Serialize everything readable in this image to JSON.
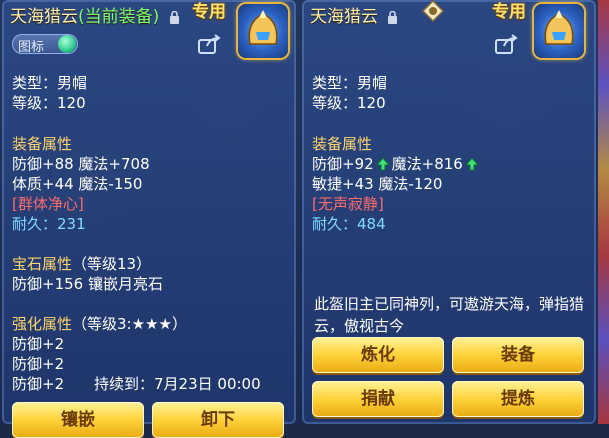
{
  "left": {
    "title": "天海猎云",
    "current_tag": "(当前装备)",
    "badge": "专用",
    "icon_toggle_label": "图标",
    "type": "类型：男帽",
    "level": "等级：120",
    "attr_header": "装备属性",
    "attr_line1": "防御+88 魔法+708",
    "attr_line2": "体质+44 魔法-150",
    "special": "[群体净心]",
    "durability": "耐久：231",
    "gem_header": "宝石属性",
    "gem_level": "（等级13）",
    "gem_line": "防御+156 镶嵌月亮石",
    "enhance_header": "强化属性",
    "enhance_level": "（等级3:",
    "enhance_stars": "★★★",
    "enhance_close": "）",
    "enhance_line1": "防御+2",
    "enhance_line2": "防御+2",
    "enhance_line3": "防御+2",
    "duration": "持续到：7月23日 00:00",
    "buttons": [
      "镶嵌",
      "卸下"
    ]
  },
  "right": {
    "title": "天海猎云",
    "badge": "专用",
    "type": "类型：男帽",
    "level": "等级：120",
    "attr_header": "装备属性",
    "attr_line1_a": "防御+92",
    "attr_line1_b": "魔法+816",
    "attr_line2": "敏捷+43 魔法-120",
    "special": "[无声寂静]",
    "durability": "耐久：484",
    "description": "此盔旧主已同神列，可遨游天海，弹指猎云，傲视古今",
    "buttons": [
      "炼化",
      "装备",
      "捐献",
      "提炼"
    ]
  },
  "colors": {
    "panel": "#2c4985",
    "header": "#ffd56a",
    "special": "#ff6a6a",
    "durability": "#7fdcff",
    "current": "#7dff6b",
    "button": "#ffd23a"
  },
  "icons": [
    "lock-icon",
    "share-icon",
    "helmet-item-icon",
    "green-up-arrow-icon",
    "appraise-badge-icon"
  ]
}
